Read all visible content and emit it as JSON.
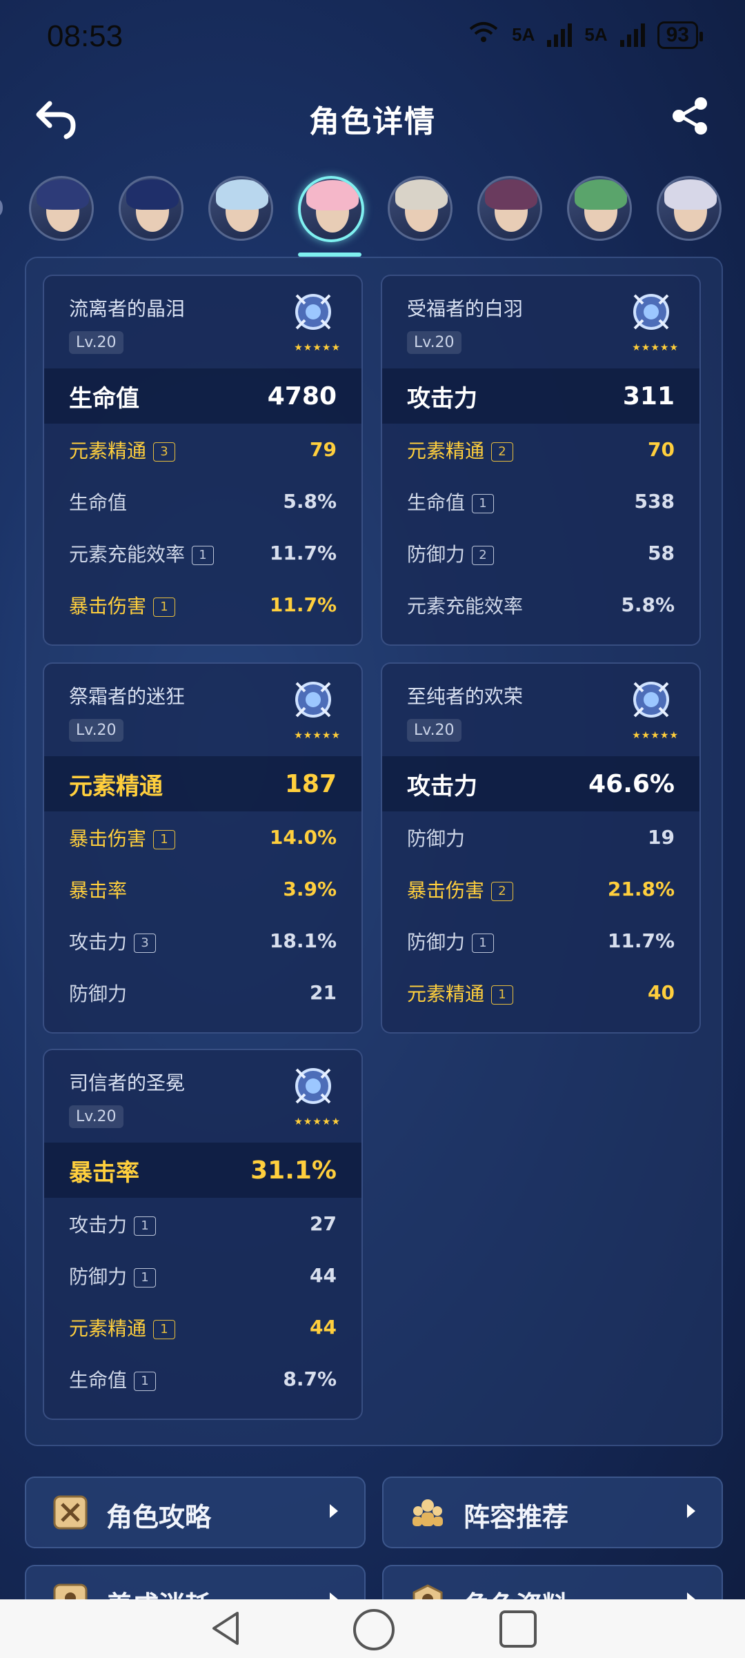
{
  "status_bar": {
    "time": "08:53",
    "wifi_label": "6",
    "signal1": "5A",
    "signal2": "5A",
    "battery": "93"
  },
  "header": {
    "title": "角色详情"
  },
  "avatars": [
    {
      "name": "avatar-1",
      "hair": "#2d3b78"
    },
    {
      "name": "avatar-2",
      "hair": "#1f2f6a"
    },
    {
      "name": "avatar-3",
      "hair": "#b9d7ee"
    },
    {
      "name": "avatar-4-selected",
      "hair": "#f5b7c9"
    },
    {
      "name": "avatar-5",
      "hair": "#d9d3c8"
    },
    {
      "name": "avatar-6",
      "hair": "#6a3b5e"
    },
    {
      "name": "avatar-7",
      "hair": "#5aa46b"
    },
    {
      "name": "avatar-8",
      "hair": "#d7d7e8"
    }
  ],
  "artifacts": [
    {
      "name": "流离者的晶泪",
      "level": "Lv.20",
      "stars": "★★★★★",
      "main": {
        "key": "生命值",
        "value": "4780",
        "gold": false
      },
      "subs": [
        {
          "key": "元素精通",
          "badge": "3",
          "value": "79",
          "gold": true
        },
        {
          "key": "生命值",
          "badge": "",
          "value": "5.8%",
          "gold": false
        },
        {
          "key": "元素充能效率",
          "badge": "1",
          "value": "11.7%",
          "gold": false
        },
        {
          "key": "暴击伤害",
          "badge": "1",
          "value": "11.7%",
          "gold": true
        }
      ]
    },
    {
      "name": "受福者的白羽",
      "level": "Lv.20",
      "stars": "★★★★★",
      "main": {
        "key": "攻击力",
        "value": "311",
        "gold": false
      },
      "subs": [
        {
          "key": "元素精通",
          "badge": "2",
          "value": "70",
          "gold": true
        },
        {
          "key": "生命值",
          "badge": "1",
          "value": "538",
          "gold": false
        },
        {
          "key": "防御力",
          "badge": "2",
          "value": "58",
          "gold": false
        },
        {
          "key": "元素充能效率",
          "badge": "",
          "value": "5.8%",
          "gold": false
        }
      ]
    },
    {
      "name": "祭霜者的迷狂",
      "level": "Lv.20",
      "stars": "★★★★★",
      "main": {
        "key": "元素精通",
        "value": "187",
        "gold": true
      },
      "subs": [
        {
          "key": "暴击伤害",
          "badge": "1",
          "value": "14.0%",
          "gold": true
        },
        {
          "key": "暴击率",
          "badge": "",
          "value": "3.9%",
          "gold": true
        },
        {
          "key": "攻击力",
          "badge": "3",
          "value": "18.1%",
          "gold": false
        },
        {
          "key": "防御力",
          "badge": "",
          "value": "21",
          "gold": false
        }
      ]
    },
    {
      "name": "至纯者的欢荣",
      "level": "Lv.20",
      "stars": "★★★★★",
      "main": {
        "key": "攻击力",
        "value": "46.6%",
        "gold": false
      },
      "subs": [
        {
          "key": "防御力",
          "badge": "",
          "value": "19",
          "gold": false
        },
        {
          "key": "暴击伤害",
          "badge": "2",
          "value": "21.8%",
          "gold": true
        },
        {
          "key": "防御力",
          "badge": "1",
          "value": "11.7%",
          "gold": false
        },
        {
          "key": "元素精通",
          "badge": "1",
          "value": "40",
          "gold": true
        }
      ]
    },
    {
      "name": "司信者的圣冕",
      "level": "Lv.20",
      "stars": "★★★★★",
      "main": {
        "key": "暴击率",
        "value": "31.1%",
        "gold": true
      },
      "subs": [
        {
          "key": "攻击力",
          "badge": "1",
          "value": "27",
          "gold": false
        },
        {
          "key": "防御力",
          "badge": "1",
          "value": "44",
          "gold": false
        },
        {
          "key": "元素精通",
          "badge": "1",
          "value": "44",
          "gold": true
        },
        {
          "key": "生命值",
          "badge": "1",
          "value": "8.7%",
          "gold": false
        }
      ]
    }
  ],
  "buttons": [
    {
      "label": "角色攻略",
      "icon": "guide-icon"
    },
    {
      "label": "阵容推荐",
      "icon": "team-icon"
    },
    {
      "label": "养成消耗",
      "icon": "cost-icon"
    },
    {
      "label": "角色资料",
      "icon": "profile-icon"
    }
  ],
  "colors": {
    "gold": "#ffcf3d",
    "accent": "#7ff0f0"
  }
}
